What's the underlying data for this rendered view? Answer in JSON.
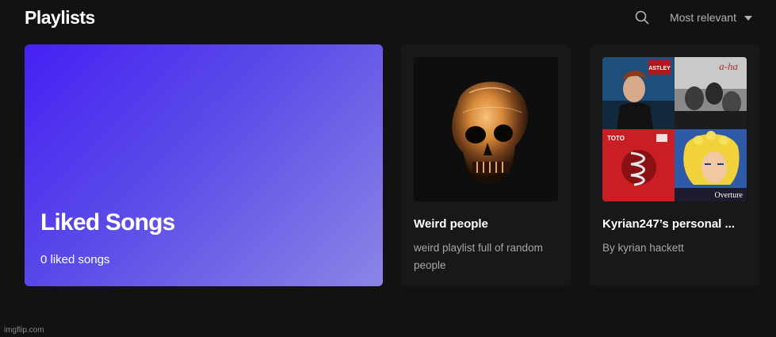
{
  "header": {
    "title": "Playlists",
    "sort_label": "Most relevant",
    "search_icon": "search-icon",
    "sort_icon": "caret-down-icon"
  },
  "liked_songs": {
    "title": "Liked Songs",
    "subtitle": "0 liked songs",
    "gradient": [
      "#4620f4",
      "#8b85e6"
    ]
  },
  "playlists": [
    {
      "name": "Weird people",
      "description": "weird playlist full of random people"
    },
    {
      "name": "Kyrian247’s personal ...",
      "description": "By kyrian hackett"
    }
  ],
  "cover_text": {
    "astley_logo": "ASTLEY",
    "aha_logo": "a-ha",
    "toto_logo": "TOTO",
    "overture": "Overture"
  },
  "watermark": "imgflip.com"
}
